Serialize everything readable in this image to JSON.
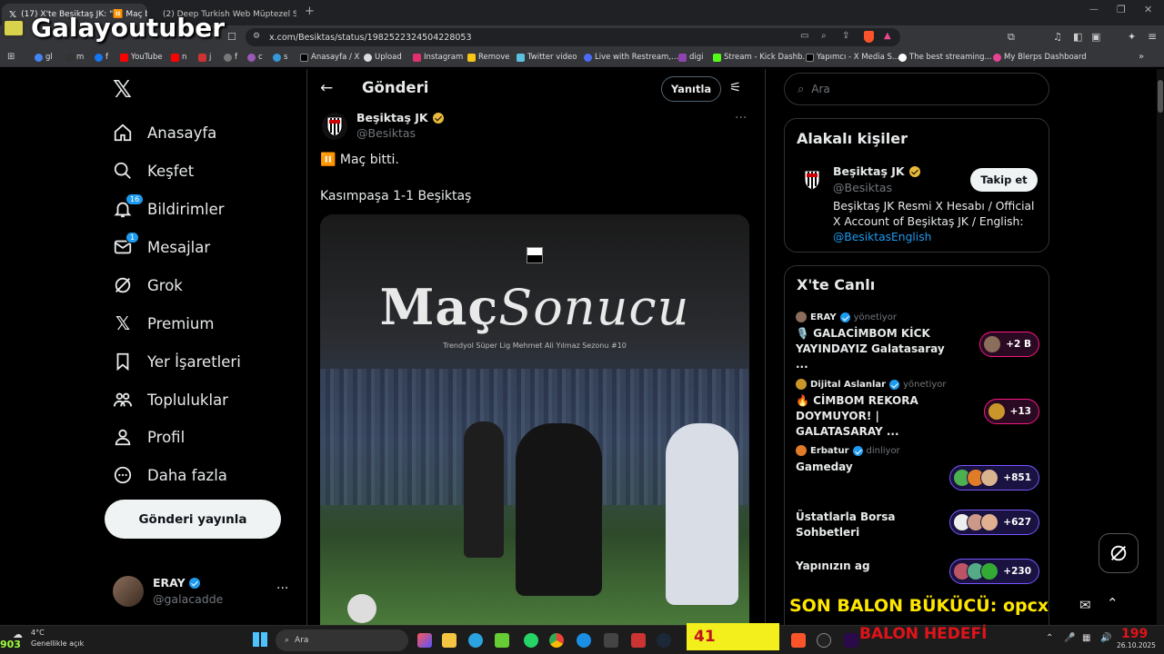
{
  "browser": {
    "tabs": [
      {
        "label": "(17) X'te Beşiktaş JK: \"⏸️ Maç bi"
      },
      {
        "label": "(2) Deep Turkish Web Müptezel S"
      }
    ],
    "url": "x.com/Besiktas/status/1982522324504228053",
    "bookmarks": [
      "gl",
      "m",
      "f",
      "YouTube",
      "n",
      "j",
      "f",
      "c",
      "s",
      "Anasayfa / X",
      "Upload",
      "Instagram",
      "Remove",
      "Twitter video",
      "Live with Restream,...",
      "digi",
      "Stream - Kick Dashb...",
      "Yapımcı - X Media S...",
      "The best streaming...",
      "My Blerps Dashboard"
    ]
  },
  "overlay": {
    "channel_name": "Galayoutuber"
  },
  "nav": {
    "items": [
      {
        "label": "Anasayfa",
        "icon": "home-icon"
      },
      {
        "label": "Keşfet",
        "icon": "search-icon"
      },
      {
        "label": "Bildirimler",
        "icon": "bell-icon",
        "badge": "16"
      },
      {
        "label": "Mesajlar",
        "icon": "mail-icon",
        "badge": "1"
      },
      {
        "label": "Grok",
        "icon": "grok-icon"
      },
      {
        "label": "Premium",
        "icon": "x-logo-icon"
      },
      {
        "label": "Yer İşaretleri",
        "icon": "bookmark-icon"
      },
      {
        "label": "Topluluklar",
        "icon": "communities-icon"
      },
      {
        "label": "Profil",
        "icon": "person-icon"
      },
      {
        "label": "Daha fazla",
        "icon": "more-circle-icon"
      }
    ],
    "post_button": "Gönderi yayınla",
    "account": {
      "name": "ERAY",
      "handle": "@galacadde",
      "more": "···"
    }
  },
  "post": {
    "header_title": "Gönderi",
    "reply_button": "Yanıtla",
    "author_name": "Beşiktaş JK",
    "author_handle": "@Besiktas",
    "more": "···",
    "line1": "⏸️ Maç bitti.",
    "line2": "Kasımpaşa 1-1 Beşiktaş",
    "media": {
      "title_bold": "Maç",
      "title_light": "Sonucu",
      "subtitle": "Trendyol Süper Lig Mehmet Ali Yılmaz Sezonu #10"
    }
  },
  "right": {
    "search_placeholder": "Ara",
    "related": {
      "title": "Alakalı kişiler",
      "name": "Beşiktaş JK",
      "handle": "@Besiktas",
      "follow": "Takip et",
      "bio": "Beşiktaş JK Resmi X Hesabı / Official X Account of Beşiktaş JK / English: ",
      "bio_link": "@BesiktasEnglish"
    },
    "live": {
      "title": "X'te Canlı",
      "rows": [
        {
          "host": "ERAY",
          "status": "yönetiyor",
          "title": "🎙️ GALACİMBOM KİCK YAYINDAYIZ Galatasaray ...",
          "count": "+2 B"
        },
        {
          "host": "Dijital Aslanlar",
          "status": "yönetiyor",
          "title": "🔥 CİMBOM REKORA DOYMUYOR! | GALATASARAY ...",
          "count": "+13"
        },
        {
          "host": "Erbatur",
          "status": "dinliyor",
          "title": "Gameday",
          "count": "+851"
        },
        {
          "host": "",
          "status": "",
          "title": "Üstatlarla Borsa Sohbetleri",
          "count": "+627"
        },
        {
          "host": "",
          "status": "",
          "title": "Yapınızın ag",
          "count": "+230"
        }
      ]
    }
  },
  "stream_overlay": {
    "son_balon": "SON BALON BÜKÜCÜ: opcx",
    "score": "41",
    "balon_hedef": "BALON HEDEFİ",
    "counter": "199"
  },
  "taskbar": {
    "weather_temp": "4°C",
    "weather_text": "Genellikle açık",
    "left_number": "903",
    "search": "Ara",
    "date": "26.10.2025"
  },
  "colors": {
    "accent": "#1d9bf0",
    "live_pink": "#f91880",
    "live_purple": "#7856ff",
    "score_bg": "#f2ef1c"
  }
}
